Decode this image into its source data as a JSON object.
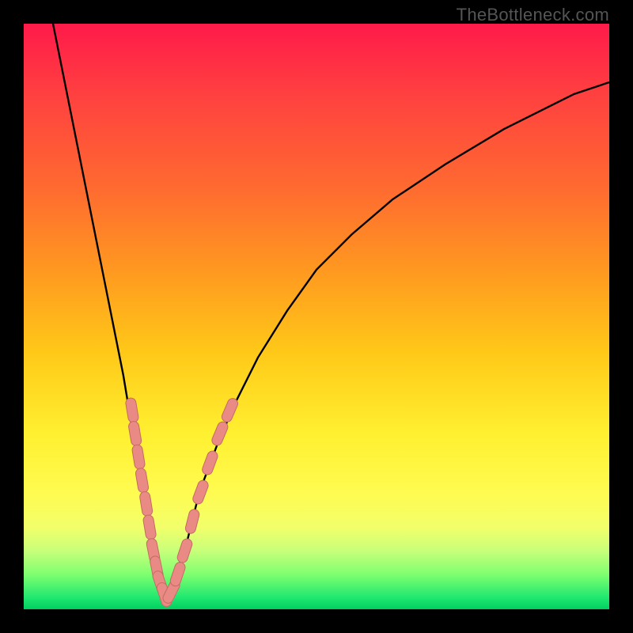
{
  "watermark": "TheBottleneck.com",
  "colors": {
    "frame": "#000000",
    "gradient_top": "#ff1a4a",
    "gradient_mid": "#fff030",
    "gradient_bottom": "#00d060",
    "curve_stroke": "#000000",
    "dot_fill": "#e98a84",
    "dot_stroke": "#c46b64"
  },
  "chart_data": {
    "type": "line",
    "title": "",
    "xlabel": "",
    "ylabel": "",
    "xlim": [
      0,
      100
    ],
    "ylim": [
      0,
      100
    ],
    "note": "x normalized 0–100 left→right, y normalized 0–100 bottom(green)→top(red). Curve is a V-shaped valley: steep left branch descending to a minimum near x≈24, then a shallower right branch rising. Dots (pink segments) cluster on both branches near the valley floor.",
    "series": [
      {
        "name": "left-branch",
        "x": [
          5,
          7,
          9,
          11,
          13,
          15,
          17,
          19,
          20,
          21,
          22,
          23,
          24
        ],
        "y": [
          100,
          90,
          80,
          70,
          60,
          50,
          40,
          28,
          22,
          16,
          10,
          5,
          2
        ]
      },
      {
        "name": "right-branch",
        "x": [
          24,
          26,
          28,
          30,
          33,
          36,
          40,
          45,
          50,
          56,
          63,
          72,
          82,
          94,
          100
        ],
        "y": [
          2,
          6,
          12,
          20,
          28,
          35,
          43,
          51,
          58,
          64,
          70,
          76,
          82,
          88,
          90
        ]
      }
    ],
    "dots_left": [
      {
        "x": 18.5,
        "y": 34
      },
      {
        "x": 19.0,
        "y": 30
      },
      {
        "x": 19.6,
        "y": 26
      },
      {
        "x": 20.2,
        "y": 22
      },
      {
        "x": 20.9,
        "y": 18
      },
      {
        "x": 21.5,
        "y": 14
      },
      {
        "x": 22.1,
        "y": 10
      },
      {
        "x": 22.7,
        "y": 7
      },
      {
        "x": 23.3,
        "y": 4.5
      },
      {
        "x": 24.0,
        "y": 2.5
      }
    ],
    "dots_right": [
      {
        "x": 25.2,
        "y": 3
      },
      {
        "x": 26.3,
        "y": 6
      },
      {
        "x": 27.5,
        "y": 10
      },
      {
        "x": 28.8,
        "y": 15
      },
      {
        "x": 30.2,
        "y": 20
      },
      {
        "x": 31.8,
        "y": 25
      },
      {
        "x": 33.5,
        "y": 30
      },
      {
        "x": 35.2,
        "y": 34
      }
    ]
  }
}
